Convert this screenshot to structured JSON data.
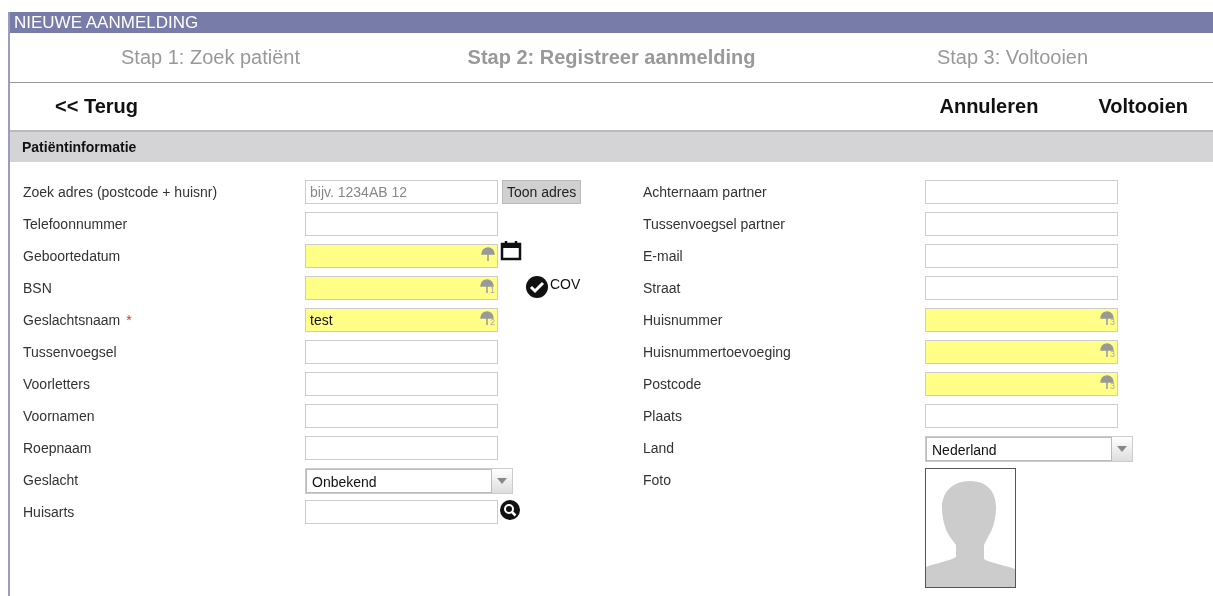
{
  "header": {
    "title": "NIEUWE AANMELDING"
  },
  "steps": [
    {
      "label": "Stap 1: Zoek patiënt",
      "selected": false
    },
    {
      "label": "Stap 2: Registreer aanmelding",
      "selected": true
    },
    {
      "label": "Stap 3: Voltooien",
      "selected": false
    }
  ],
  "actions": {
    "back": "<< Terug",
    "cancel": "Annuleren",
    "finish": "Voltooien"
  },
  "section": {
    "title": "Patiëntinformatie"
  },
  "left_fields": [
    {
      "kind": "address",
      "label": "Zoek adres (postcode + huisnr)",
      "placeholder": "bijv. 1234AB 12",
      "button": "Toon adres"
    },
    {
      "kind": "text",
      "label": "Telefoonnummer"
    },
    {
      "kind": "date",
      "label": "Geboortedatum",
      "highlighted": true
    },
    {
      "kind": "text",
      "label": "BSN",
      "highlighted": true,
      "marker": "1",
      "badge": "COV"
    },
    {
      "kind": "text",
      "label": "Geslachtsnaam",
      "highlighted": true,
      "marker": "2",
      "required_mark": "*",
      "value": "test"
    },
    {
      "kind": "text",
      "label": "Tussenvoegsel"
    },
    {
      "kind": "text",
      "label": "Voorletters"
    },
    {
      "kind": "text",
      "label": "Voornamen"
    },
    {
      "kind": "text",
      "label": "Roepnaam"
    },
    {
      "kind": "select",
      "label": "Geslacht",
      "value": "Onbekend"
    },
    {
      "kind": "lookup",
      "label": "Huisarts"
    }
  ],
  "right_fields": [
    {
      "kind": "text",
      "label": "Achternaam partner"
    },
    {
      "kind": "text",
      "label": "Tussenvoegsel partner"
    },
    {
      "kind": "text",
      "label": "E-mail"
    },
    {
      "kind": "text",
      "label": "Straat"
    },
    {
      "kind": "text",
      "label": "Huisnummer",
      "highlighted": true,
      "marker": "3"
    },
    {
      "kind": "text",
      "label": "Huisnummertoevoeging",
      "highlighted": true,
      "marker": "3"
    },
    {
      "kind": "text",
      "label": "Postcode",
      "highlighted": true,
      "marker": "3"
    },
    {
      "kind": "text",
      "label": "Plaats"
    },
    {
      "kind": "select",
      "label": "Land",
      "value": "Nederland"
    },
    {
      "kind": "photo",
      "label": "Foto"
    }
  ]
}
